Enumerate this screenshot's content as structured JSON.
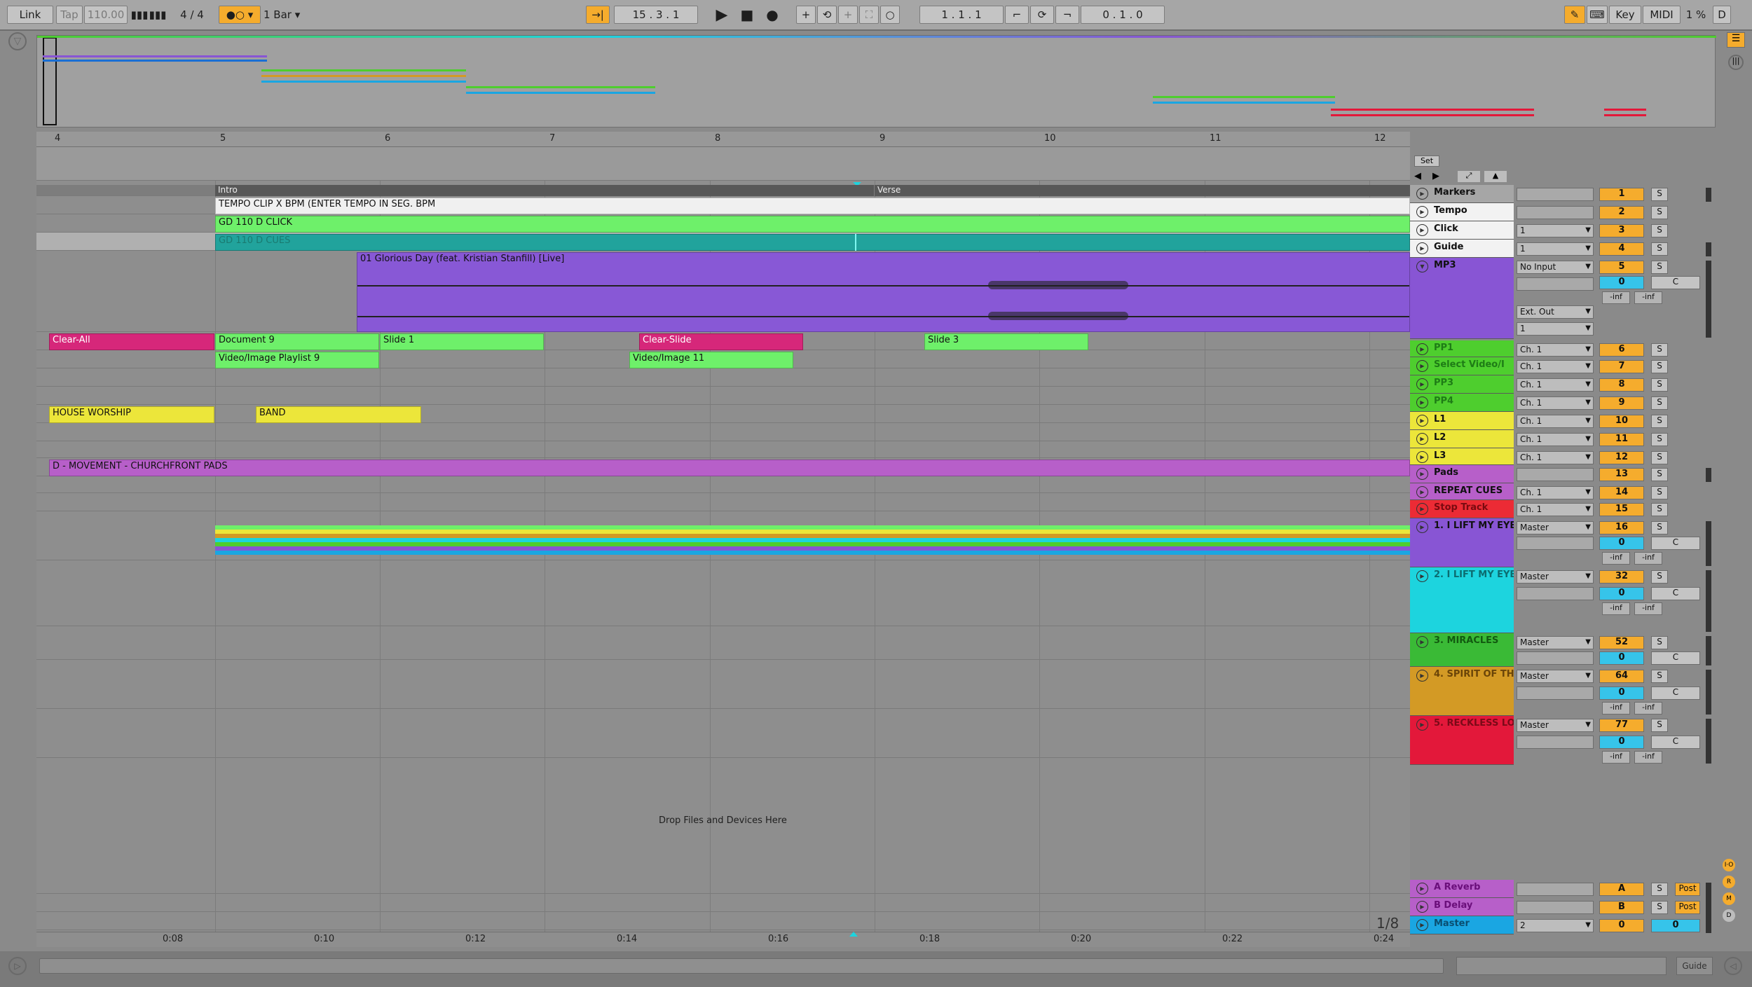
{
  "transport": {
    "link": "Link",
    "tap": "Tap",
    "tempo": "110.00",
    "signature": "4 / 4",
    "quantize": "1 Bar",
    "position": "15 .   3 .   1",
    "loop_start": "1 .   1 .   1",
    "loop_length": "0 .   1 .   0",
    "key": "Key",
    "midi": "MIDI",
    "cpu": "1 %",
    "d": "D"
  },
  "ruler": {
    "bars": [
      "4",
      "5",
      "6",
      "7",
      "8",
      "9",
      "10",
      "11",
      "12"
    ],
    "times": [
      "0:08",
      "0:10",
      "0:12",
      "0:14",
      "0:16",
      "0:18",
      "0:20",
      "0:22",
      "0:24"
    ]
  },
  "markers_lane": {
    "set_label": "Set",
    "locators": [
      "Intro",
      "Verse"
    ]
  },
  "clips": {
    "tempo": "TEMPO CLIP X BPM (ENTER TEMPO IN SEG. BPM",
    "click": "GD  110  D  CLICK",
    "guide": "GD  110  D  CUES",
    "mp3": "01 Glorious Day (feat. Kristian Stanfill) [Live]",
    "pp1": [
      "Clear-All",
      "Document 9",
      "Slide 1",
      "Clear-Slide",
      "Slide 3"
    ],
    "video": [
      "Video/Image Playlist 9",
      "Video/Image 11"
    ],
    "l1": [
      "HOUSE WORSHIP",
      "BAND"
    ],
    "pads": "D - MOVEMENT - CHURCHFRONT PADS",
    "drop": "Drop Files and Devices Here"
  },
  "tracks": [
    {
      "name": "Markers",
      "color": "#a0a0a0",
      "io": "",
      "num": "1"
    },
    {
      "name": "Tempo",
      "color": "#f2f2f2",
      "io": "",
      "num": "2"
    },
    {
      "name": "Click",
      "color": "#f2f2f2",
      "io": "1",
      "num": "3"
    },
    {
      "name": "Guide",
      "color": "#f2f2f2",
      "io": "1",
      "num": "4"
    },
    {
      "name": "MP3",
      "color": "#8855d4",
      "io": "No Input",
      "num": "5"
    },
    {
      "name": "PP1",
      "color": "#4ece2e",
      "io": "Ch. 1",
      "num": "6"
    },
    {
      "name": "Select Video/I",
      "color": "#4ece2e",
      "io": "Ch. 1",
      "num": "7"
    },
    {
      "name": "PP3",
      "color": "#4ece2e",
      "io": "Ch. 1",
      "num": "8"
    },
    {
      "name": "PP4",
      "color": "#4ece2e",
      "io": "Ch. 1",
      "num": "9"
    },
    {
      "name": "L1",
      "color": "#ece63a",
      "io": "Ch. 1",
      "num": "10"
    },
    {
      "name": "L2",
      "color": "#ece63a",
      "io": "Ch. 1",
      "num": "11"
    },
    {
      "name": "L3",
      "color": "#ece63a",
      "io": "Ch. 1",
      "num": "12"
    },
    {
      "name": "Pads",
      "color": "#b75fc9",
      "io": "",
      "num": "13"
    },
    {
      "name": "REPEAT CUES",
      "color": "#b75fc9",
      "io": "Ch. 1",
      "num": "14"
    },
    {
      "name": "Stop Track",
      "color": "#ec2b35",
      "io": "Ch. 1",
      "num": "15"
    },
    {
      "name": "1. I LIFT MY EYE",
      "color": "#8855d4",
      "io": "Master",
      "num": "16"
    },
    {
      "name": "2. I LIFT MY EYE",
      "color": "#1dd4de",
      "io": "Master",
      "num": "32"
    },
    {
      "name": "3. MIRACLES",
      "color": "#3aba36",
      "io": "Master",
      "num": "52"
    },
    {
      "name": "4. SPIRIT OF TH",
      "color": "#d39a25",
      "io": "Master",
      "num": "64"
    },
    {
      "name": "5. RECKLESS LO",
      "color": "#e3183a",
      "io": "Master",
      "num": "77"
    }
  ],
  "returns": [
    {
      "name": "A Reverb",
      "color": "#b75fc9",
      "num": "A",
      "post": "Post"
    },
    {
      "name": "B Delay",
      "color": "#b75fc9",
      "num": "B",
      "post": "Post"
    },
    {
      "name": "Master",
      "color": "#1aa6e2",
      "num": "0",
      "io": "2",
      "vol": "0"
    }
  ],
  "mixer": {
    "solo": "S",
    "center": "C",
    "vol_zero": "0",
    "inf": "-inf",
    "ext_out": "Ext. Out",
    "ext_ch": "1"
  },
  "page_counter": "1/8",
  "status": {
    "guide": "Guide"
  }
}
